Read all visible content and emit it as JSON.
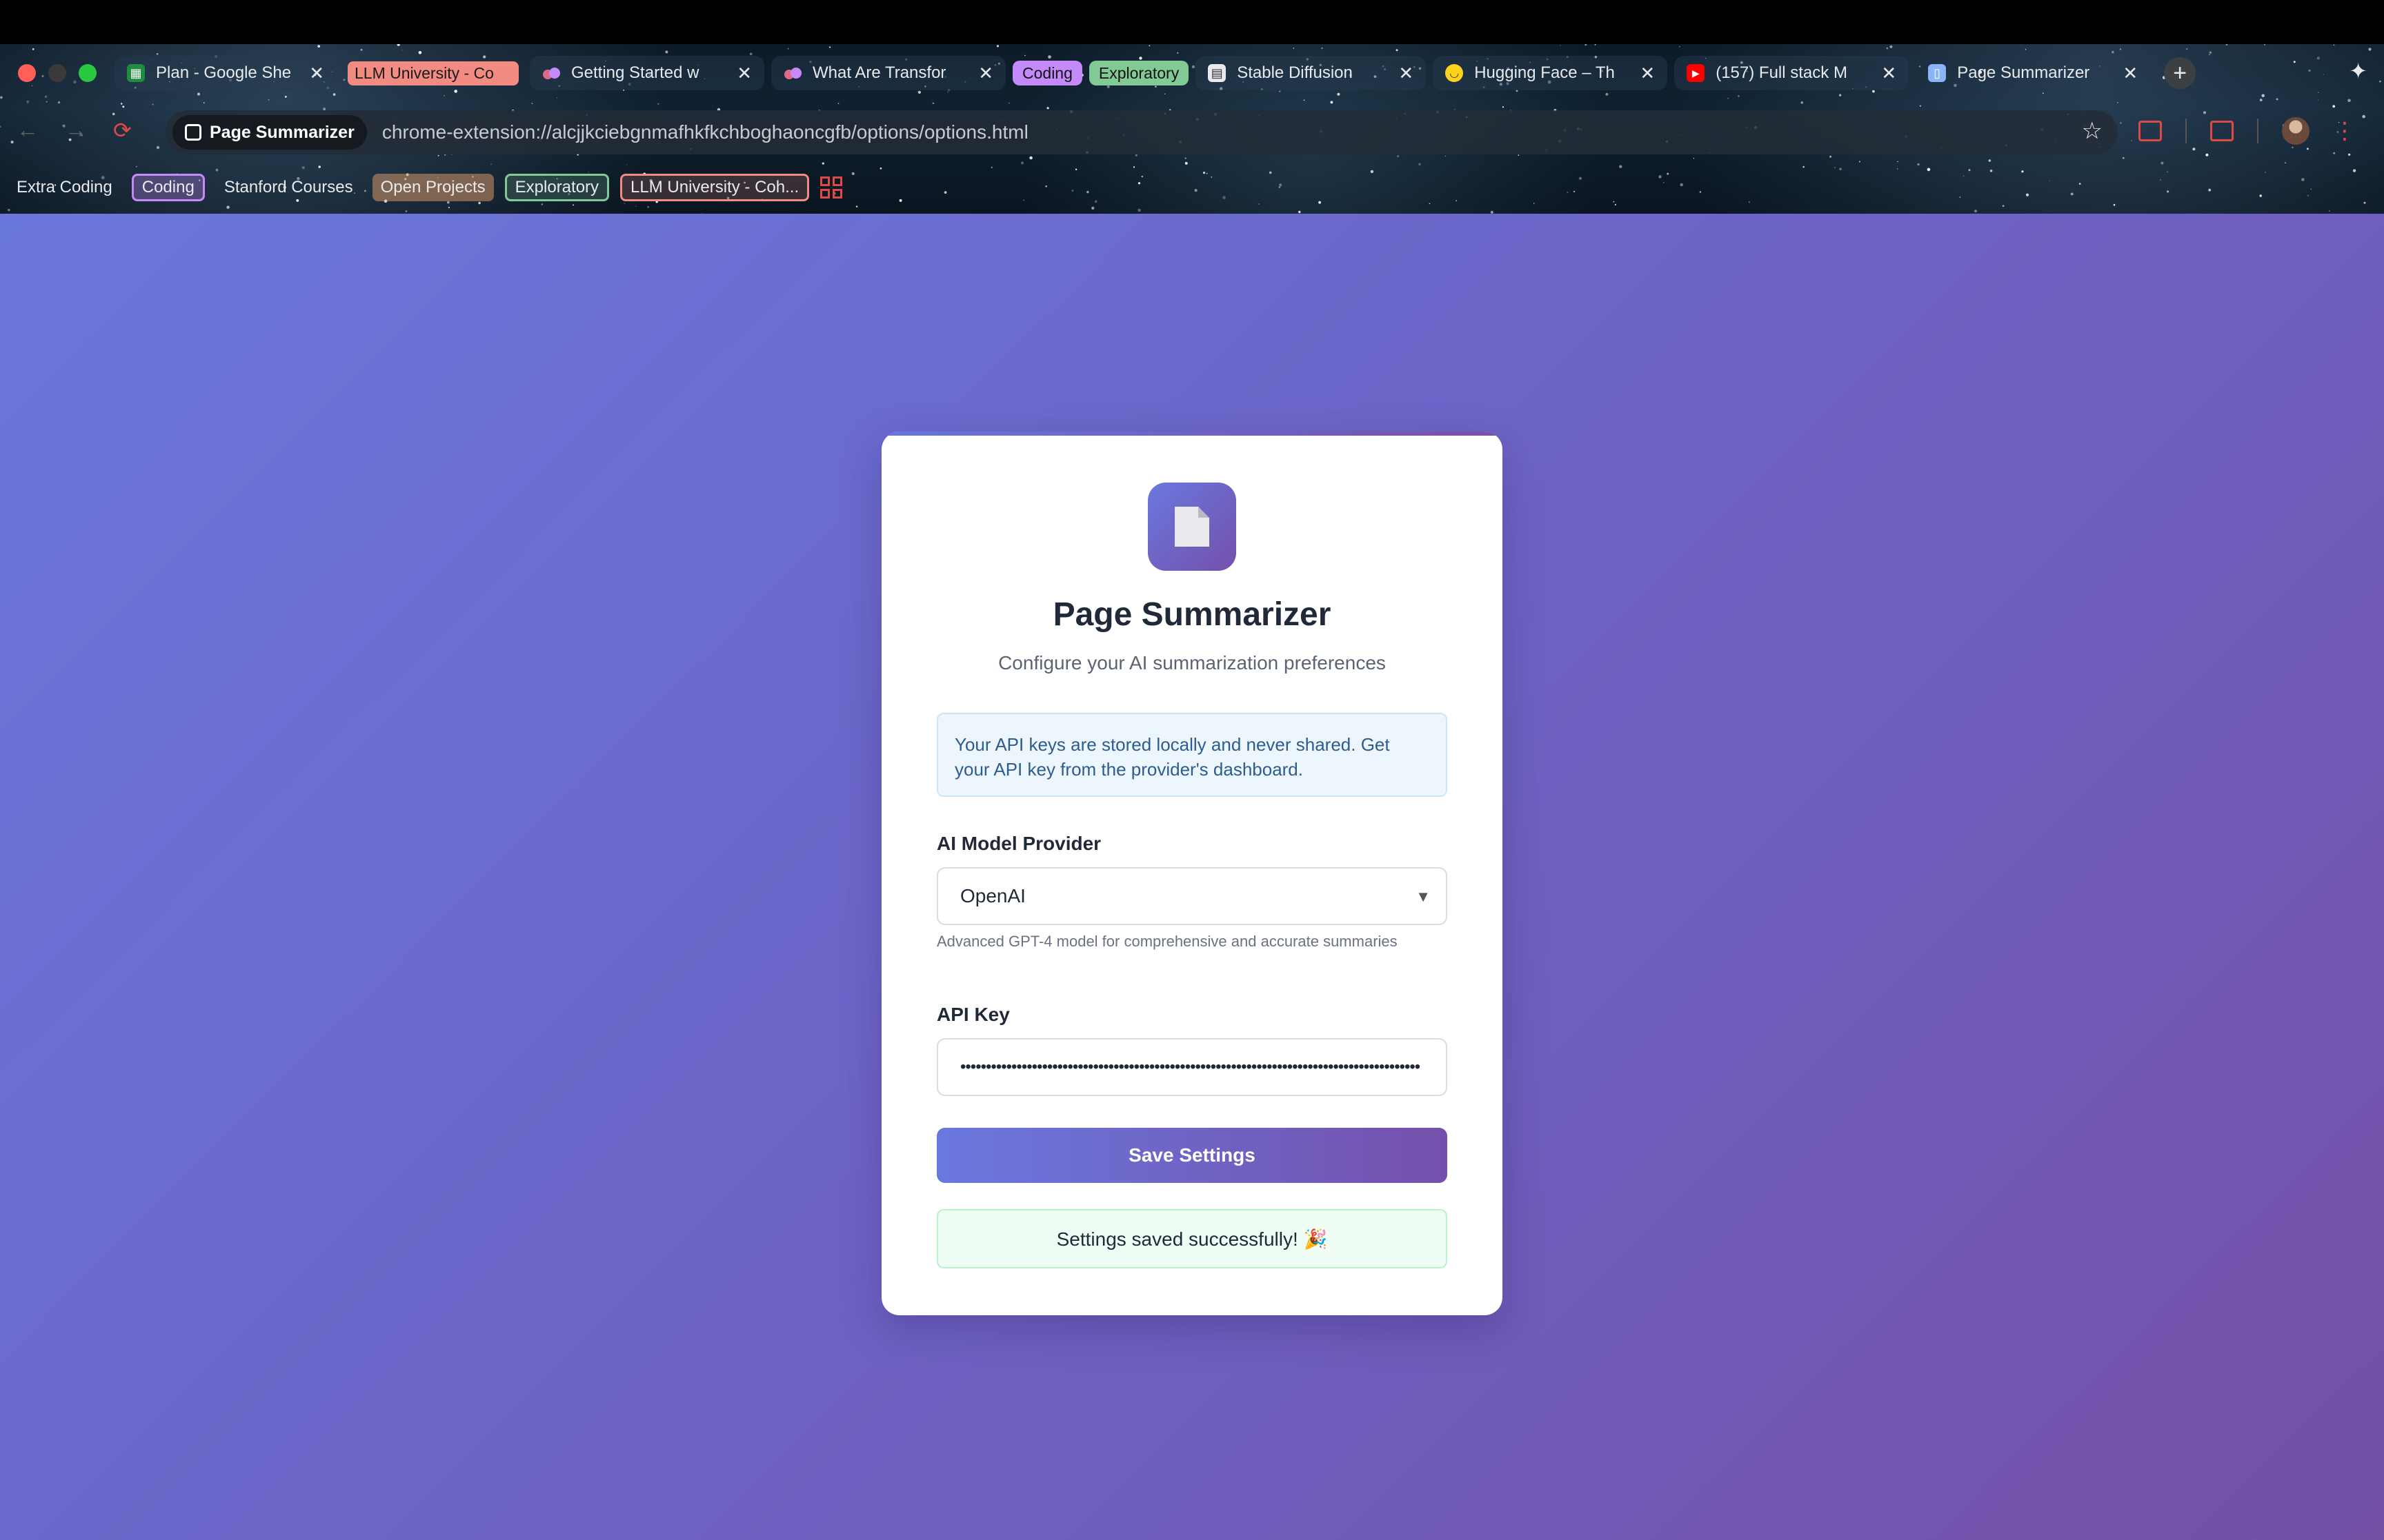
{
  "browser": {
    "tabs": [
      {
        "label": "Plan - Google She",
        "favicon": "sheets-icon",
        "fav_color": "#1e8e3e"
      },
      {
        "label": "LLM University - Co",
        "favicon": "",
        "group_color": "#f28b82",
        "highlighted": true
      },
      {
        "label": "Getting Started w",
        "favicon": "cohere-icon",
        "fav_color": "#c58af9"
      },
      {
        "label": "What Are Transfor",
        "favicon": "cohere-icon",
        "fav_color": "#c58af9"
      },
      {
        "label": "Stable Diffusion",
        "favicon": "doc-icon",
        "fav_color": "#e8eaed"
      },
      {
        "label": "Hugging Face – Th",
        "favicon": "hugging-face-icon",
        "fav_color": "#ffd21e"
      },
      {
        "label": "(157) Full stack M",
        "favicon": "youtube-icon",
        "fav_color": "#ff0000"
      },
      {
        "label": "Page Summarizer",
        "favicon": "extension-icon",
        "fav_color": "#8ab4f8"
      }
    ],
    "group_chips": [
      {
        "label": "Coding",
        "color": "#c58af9"
      },
      {
        "label": "Exploratory",
        "color": "#81c995"
      }
    ],
    "close_glyph": "✕",
    "new_tab_glyph": "+",
    "site_chip_label": "Page Summarizer",
    "url": "chrome-extension://alcjjkciebgnmafhkfkchboghaoncgfb/options/options.html",
    "bookmarks": [
      {
        "label": "Extra Coding",
        "style": "plain"
      },
      {
        "label": "Coding",
        "style": "outlined",
        "color": "#c58af9",
        "bg": "rgba(197,138,249,0.3)"
      },
      {
        "label": "Stanford Courses",
        "style": "plain"
      },
      {
        "label": "Open Projects",
        "style": "filled",
        "color": "#fcad70",
        "bg": "rgba(252,173,112,0.45)"
      },
      {
        "label": "Exploratory",
        "style": "outlined",
        "color": "#81c995",
        "bg": "rgba(129,201,149,0.2)"
      },
      {
        "label": "LLM University - Coh...",
        "style": "outlined",
        "color": "#f28b82",
        "bg": "rgba(242,139,130,0.2)"
      }
    ]
  },
  "app": {
    "title": "Page Summarizer",
    "subtitle": "Configure your AI summarization preferences",
    "info": "Your API keys are stored locally and never shared. Get your API key from the provider's dashboard.",
    "provider_label": "AI Model Provider",
    "provider_value": "OpenAI",
    "provider_help": "Advanced GPT-4 model for comprehensive and accurate summaries",
    "api_key_label": "API Key",
    "api_key_value": "••••••••••••••••••••••••••••••••••••••••••••••••••••••••••••••••••••••••••••••••••••••••••",
    "save_label": "Save Settings",
    "success_message": "Settings saved successfully! 🎉",
    "dropdown_glyph": "▼"
  },
  "colors": {
    "accent_start": "#6a78de",
    "accent_end": "#7450ab",
    "background_start": "#6a77da",
    "background_end": "#7350a6"
  }
}
